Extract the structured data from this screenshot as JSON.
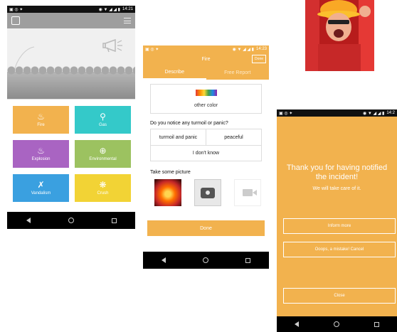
{
  "colors": {
    "orange": "#f2b24e",
    "statusbar": "#111111",
    "navbar": "#000000"
  },
  "status": {
    "time1": "14:21",
    "time2": "14:23",
    "time3": "14:2"
  },
  "phone1": {
    "menu_icon": "hamburger-icon",
    "tiles": [
      {
        "label": "Fire",
        "icon": "fire-icon",
        "color": "#f2b24e"
      },
      {
        "label": "Gas",
        "icon": "gas-tap-icon",
        "color": "#34c9c9"
      },
      {
        "label": "Explosion",
        "icon": "explosion-icon",
        "color": "#a964c2"
      },
      {
        "label": "Environmental",
        "icon": "globe-icon",
        "color": "#9cc260"
      },
      {
        "label": "Vandalism",
        "icon": "vandalism-icon",
        "color": "#3aa0e0"
      },
      {
        "label": "Crush",
        "icon": "crush-icon",
        "color": "#f2d335"
      }
    ]
  },
  "phone2": {
    "title": "Fire",
    "done_top": "Done",
    "tabs": [
      "Describe",
      "Free Report"
    ],
    "color_label": "other color",
    "question": "Do you notice any turmoil or panic?",
    "options": [
      "turmoil and panic",
      "peaceful",
      "I don't know"
    ],
    "picture_label": "Take some picture",
    "done_bottom": "Done"
  },
  "phone3": {
    "thanks": "Thank you for having notified the incident!",
    "take_care": "We will take care of it.",
    "inform_more": "Inform more",
    "mistake": "Ooops, a mistake! Cancel",
    "close": "Close"
  }
}
